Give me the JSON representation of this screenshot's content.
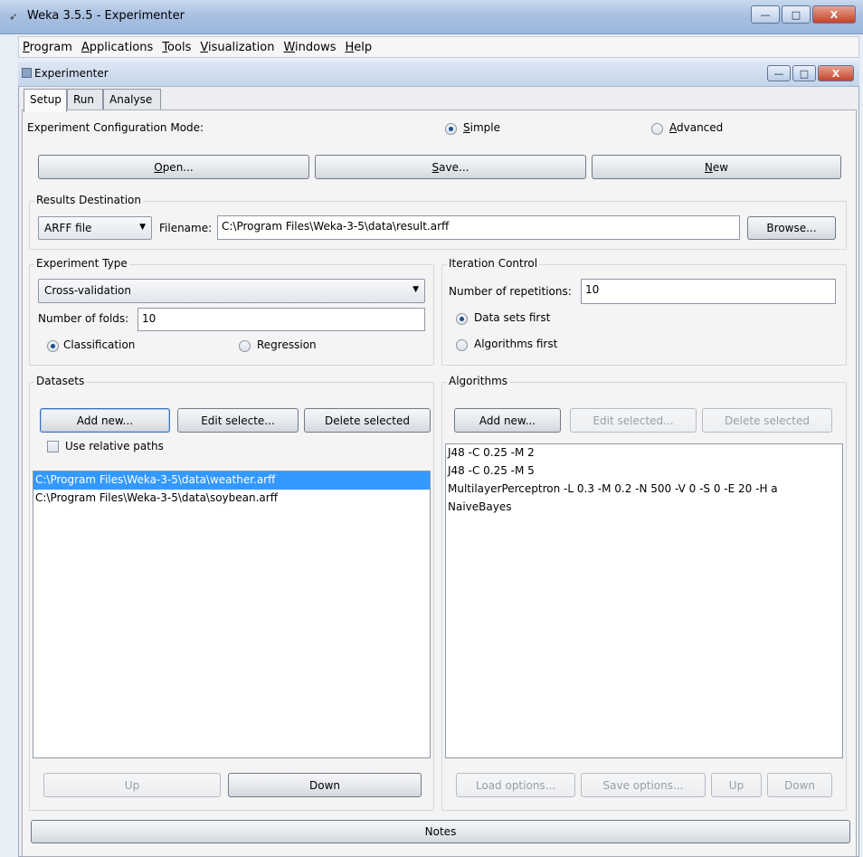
{
  "window": {
    "title": "Weka 3.5.5 - Experimenter",
    "minimize_label": "—",
    "maximize_label": "□",
    "close_label": "X"
  },
  "menu": [
    {
      "label": "Program",
      "underline": "P",
      "rest": "rogram"
    },
    {
      "label": "Applications",
      "underline": "A",
      "rest": "pplications"
    },
    {
      "label": "Tools",
      "underline": "T",
      "rest": "ools"
    },
    {
      "label": "Visualization",
      "underline": "V",
      "rest": "isualization"
    },
    {
      "label": "Windows",
      "underline": "W",
      "rest": "indows"
    },
    {
      "label": "Help",
      "underline": "H",
      "rest": "elp"
    }
  ],
  "inner_window": {
    "title": "Experimenter"
  },
  "tabs": [
    {
      "label": "Setup",
      "active": true
    },
    {
      "label": "Run",
      "active": false
    },
    {
      "label": "Analyse",
      "active": false
    }
  ],
  "config_mode": {
    "label": "Experiment Configuration Mode:",
    "simple_u": "S",
    "simple_rest": "imple",
    "advanced_u": "A",
    "advanced_rest": "dvanced",
    "selected": "Simple"
  },
  "toolbar": {
    "open_u": "O",
    "open_rest": "pen...",
    "save_u": "S",
    "save_rest": "ave...",
    "new_u": "N",
    "new_rest": "ew"
  },
  "results_destination": {
    "title": "Results Destination",
    "type": "ARFF file",
    "filename_label": "Filename:",
    "filename": "C:\\Program Files\\Weka-3-5\\data\\result.arff",
    "browse_label": "Browse..."
  },
  "experiment_type": {
    "title": "Experiment Type",
    "type": "Cross-validation",
    "folds_label": "Number of folds:",
    "folds": "10",
    "classification_label": "Classification",
    "regression_label": "Regression",
    "selected": "Classification"
  },
  "iteration_control": {
    "title": "Iteration Control",
    "repetitions_label": "Number of repetitions:",
    "repetitions": "10",
    "data_first_label": "Data sets first",
    "algorithms_first_label": "Algorithms first",
    "selected": "Data sets first"
  },
  "datasets": {
    "title": "Datasets",
    "add_new_label": "Add new...",
    "edit_selected_label": "Edit selecte...",
    "delete_selected_label": "Delete selected",
    "relative_paths_label": "Use relative paths",
    "items": [
      {
        "path": "C:\\Program Files\\Weka-3-5\\data\\weather.arff",
        "selected": true
      },
      {
        "path": "C:\\Program Files\\Weka-3-5\\data\\soybean.arff",
        "selected": false
      }
    ],
    "up_label": "Up",
    "down_label": "Down"
  },
  "algorithms": {
    "title": "Algorithms",
    "add_new_label": "Add new...",
    "edit_selected_label": "Edit selected...",
    "delete_selected_label": "Delete selected",
    "items": [
      "J48 -C 0.25 -M 2",
      "J48 -C 0.25 -M 5",
      "MultilayerPerceptron -L 0.3 -M 0.2 -N 500 -V 0 -S 0 -E 20 -H a",
      "NaiveBayes"
    ],
    "load_options_label": "Load options...",
    "save_options_label": "Save options...",
    "up_label": "Up",
    "down_label": "Down"
  },
  "notes_label": "Notes"
}
